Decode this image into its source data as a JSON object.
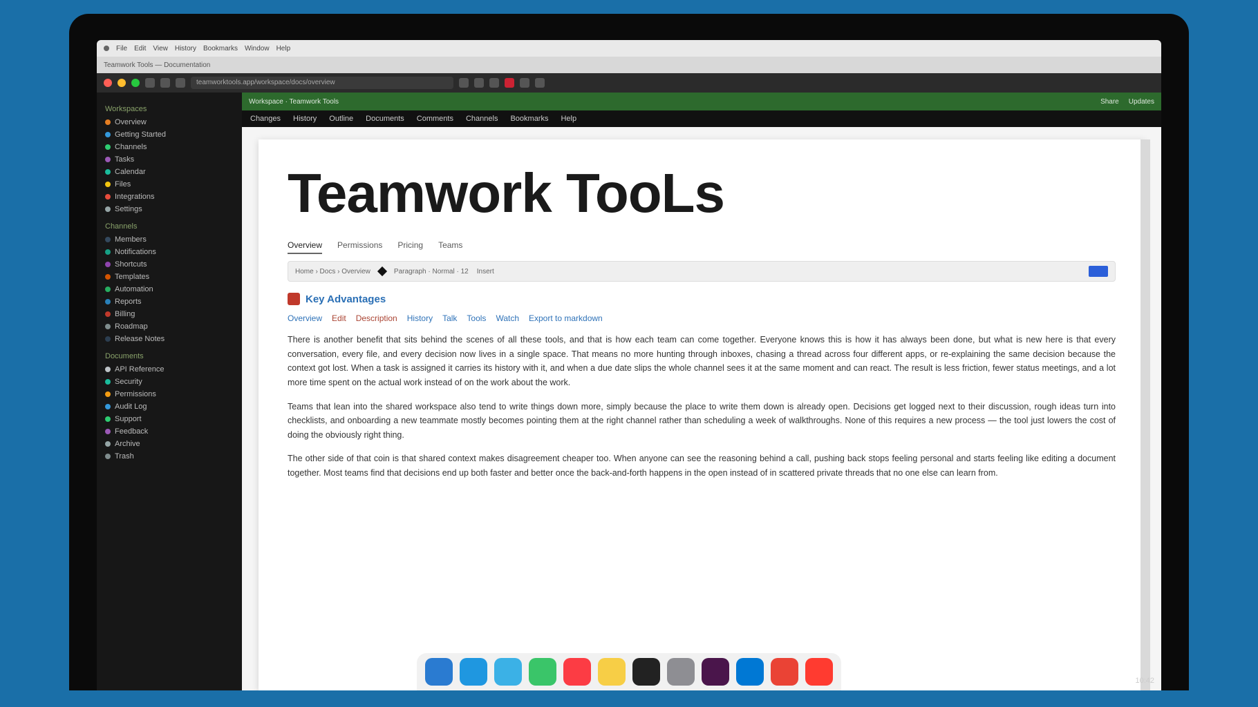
{
  "os_menubar": {
    "items": [
      "File",
      "Edit",
      "View",
      "History",
      "Bookmarks",
      "Window",
      "Help"
    ]
  },
  "browser": {
    "tab_label": "Teamwork Tools — Documentation",
    "url": "teamworktools.app/workspace/docs/overview"
  },
  "app_topbar": {
    "workspace": "Workspace · Teamwork Tools",
    "share": "Share",
    "updates": "Updates"
  },
  "app_menubar": {
    "items": [
      "Changes",
      "History",
      "Outline",
      "Documents",
      "Comments",
      "Channels",
      "Bookmarks",
      "Help"
    ]
  },
  "sidebar": {
    "group1": "Workspaces",
    "group2": "Channels",
    "group3": "Documents",
    "items": [
      {
        "label": "Overview",
        "color": "#e67e22"
      },
      {
        "label": "Getting Started",
        "color": "#3498db"
      },
      {
        "label": "Channels",
        "color": "#2ecc71"
      },
      {
        "label": "Tasks",
        "color": "#9b59b6"
      },
      {
        "label": "Calendar",
        "color": "#1abc9c"
      },
      {
        "label": "Files",
        "color": "#f1c40f"
      },
      {
        "label": "Integrations",
        "color": "#e74c3c"
      },
      {
        "label": "Settings",
        "color": "#95a5a6"
      },
      {
        "label": "Members",
        "color": "#34495e"
      },
      {
        "label": "Notifications",
        "color": "#16a085"
      },
      {
        "label": "Shortcuts",
        "color": "#8e44ad"
      },
      {
        "label": "Templates",
        "color": "#d35400"
      },
      {
        "label": "Automation",
        "color": "#27ae60"
      },
      {
        "label": "Reports",
        "color": "#2980b9"
      },
      {
        "label": "Billing",
        "color": "#c0392b"
      },
      {
        "label": "Roadmap",
        "color": "#7f8c8d"
      },
      {
        "label": "Release Notes",
        "color": "#2c3e50"
      },
      {
        "label": "API Reference",
        "color": "#bdc3c7"
      },
      {
        "label": "Security",
        "color": "#1abc9c"
      },
      {
        "label": "Permissions",
        "color": "#f39c12"
      },
      {
        "label": "Audit Log",
        "color": "#3498db"
      },
      {
        "label": "Support",
        "color": "#2ecc71"
      },
      {
        "label": "Feedback",
        "color": "#9b59b6"
      },
      {
        "label": "Archive",
        "color": "#95a5a6"
      },
      {
        "label": "Trash",
        "color": "#7f8c8d"
      }
    ]
  },
  "doc": {
    "title": "Teamwork TooLs",
    "subtabs": [
      "Overview",
      "Permissions",
      "Pricing",
      "Teams"
    ],
    "toolbar": {
      "breadcrumb": "Home › Docs › Overview",
      "format": "Paragraph · Normal · 12",
      "insert": "Insert"
    },
    "section_heading": "Key Advantages",
    "links": [
      "Overview",
      "Edit",
      "Description",
      "History",
      "Talk",
      "Tools",
      "Watch",
      "Export to markdown"
    ],
    "paragraphs": [
      "There is another benefit that sits behind the scenes of all these tools, and that is how each team can come together. Everyone knows this is how it has always been done, but what is new here is that every conversation, every file, and every decision now lives in a single space. That means no more hunting through inboxes, chasing a thread across four different apps, or re-explaining the same decision because the context got lost. When a task is assigned it carries its history with it, and when a due date slips the whole channel sees it at the same moment and can react. The result is less friction, fewer status meetings, and a lot more time spent on the actual work instead of on the work about the work.",
      "Teams that lean into the shared workspace also tend to write things down more, simply because the place to write them down is already open. Decisions get logged next to their discussion, rough ideas turn into checklists, and onboarding a new teammate mostly becomes pointing them at the right channel rather than scheduling a week of walkthroughs. None of this requires a new process — the tool just lowers the cost of doing the obviously right thing.",
      "The other side of that coin is that shared context makes disagreement cheaper too. When anyone can see the reasoning behind a call, pushing back stops feeling personal and starts feeling like editing a document together. Most teams find that decisions end up both faster and better once the back-and-forth happens in the open instead of in scattered private threads that no one else can learn from."
    ]
  },
  "dock": {
    "apps": [
      {
        "name": "finder",
        "color": "#2a7bd1"
      },
      {
        "name": "safari",
        "color": "#1f97e0"
      },
      {
        "name": "mail",
        "color": "#3bb1e6"
      },
      {
        "name": "messages",
        "color": "#3ac569"
      },
      {
        "name": "music",
        "color": "#fc3c44"
      },
      {
        "name": "notes",
        "color": "#f7ce46"
      },
      {
        "name": "terminal",
        "color": "#222"
      },
      {
        "name": "settings",
        "color": "#8e8e93"
      },
      {
        "name": "slack",
        "color": "#4a154b"
      },
      {
        "name": "vscode",
        "color": "#0078d4"
      },
      {
        "name": "browser",
        "color": "#ea4335"
      },
      {
        "name": "calendar",
        "color": "#ff3b30"
      }
    ]
  },
  "clock": "10:42"
}
